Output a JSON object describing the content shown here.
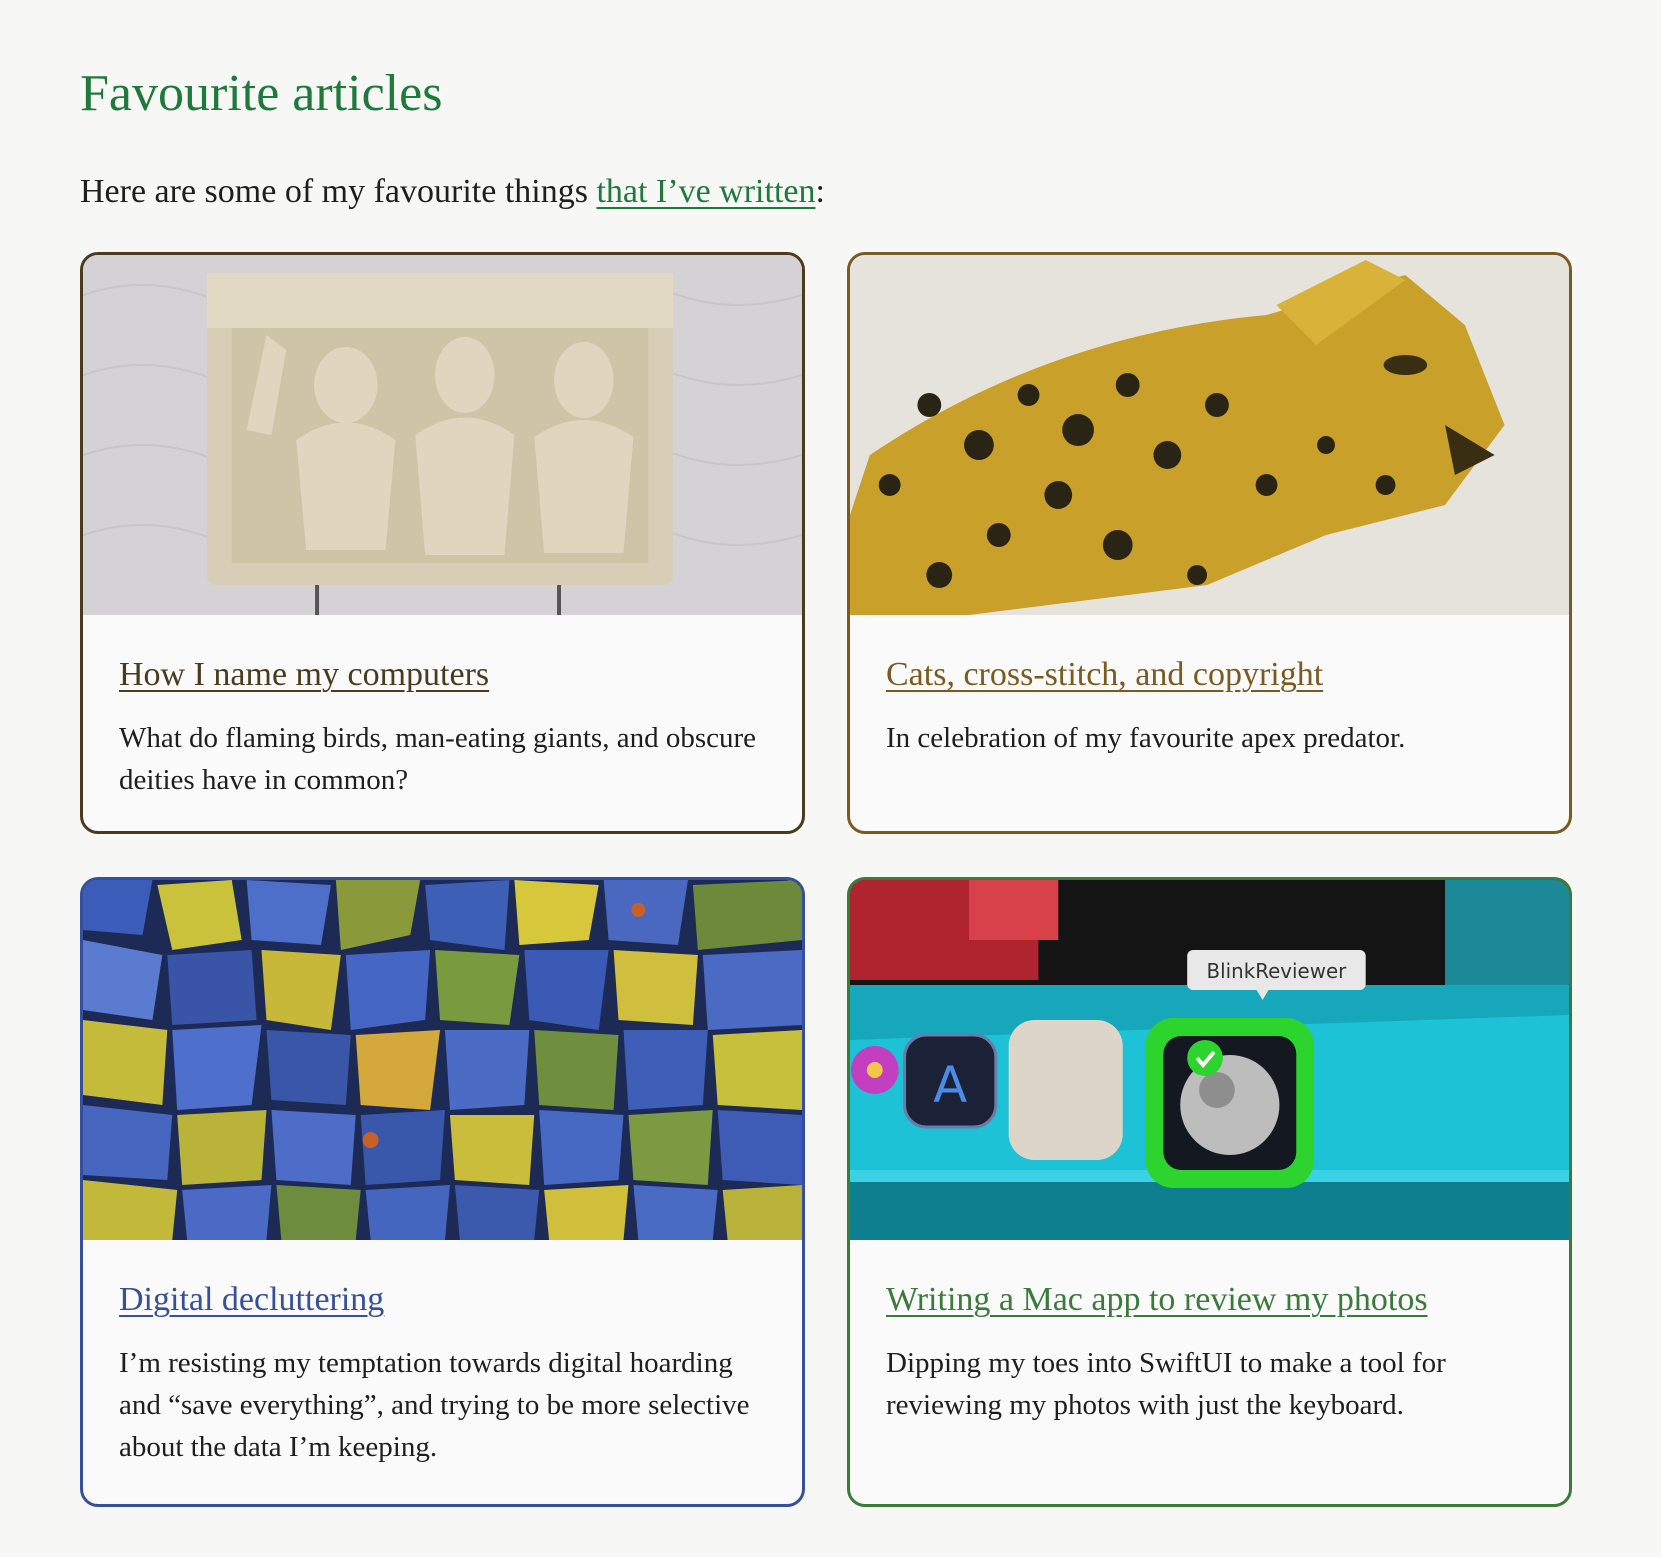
{
  "page": {
    "title": "Favourite articles",
    "intro_prefix": "Here are some of my favourite things ",
    "intro_link": "that I’ve written",
    "intro_suffix": ":"
  },
  "cards": [
    {
      "title": "How I name my computers",
      "description": "What do flaming birds, man-eating giants, and obscure deities have in common?",
      "accent": "#4a3a1e",
      "image": "stone-relief-carving"
    },
    {
      "title": "Cats, cross-stitch, and copyright",
      "description": "In celebration of my favourite apex predator.",
      "accent": "#7a5a1e",
      "image": "cross-stitch-leopard"
    },
    {
      "title": "Digital decluttering",
      "description": "I’m resisting my temptation towards digital hoarding and “save everything”, and trying to be more selective about the data I’m keeping.",
      "accent": "#354f9c",
      "image": "blue-yellow-rocks"
    },
    {
      "title": "Writing a Mac app to review my photos",
      "description": "Dipping my toes into SwiftUI to make a tool for reviewing my photos with just the keyboard.",
      "accent": "#3a7a3a",
      "image": "mac-dock-app-icon",
      "image_tooltip": "BlinkReviewer"
    }
  ]
}
